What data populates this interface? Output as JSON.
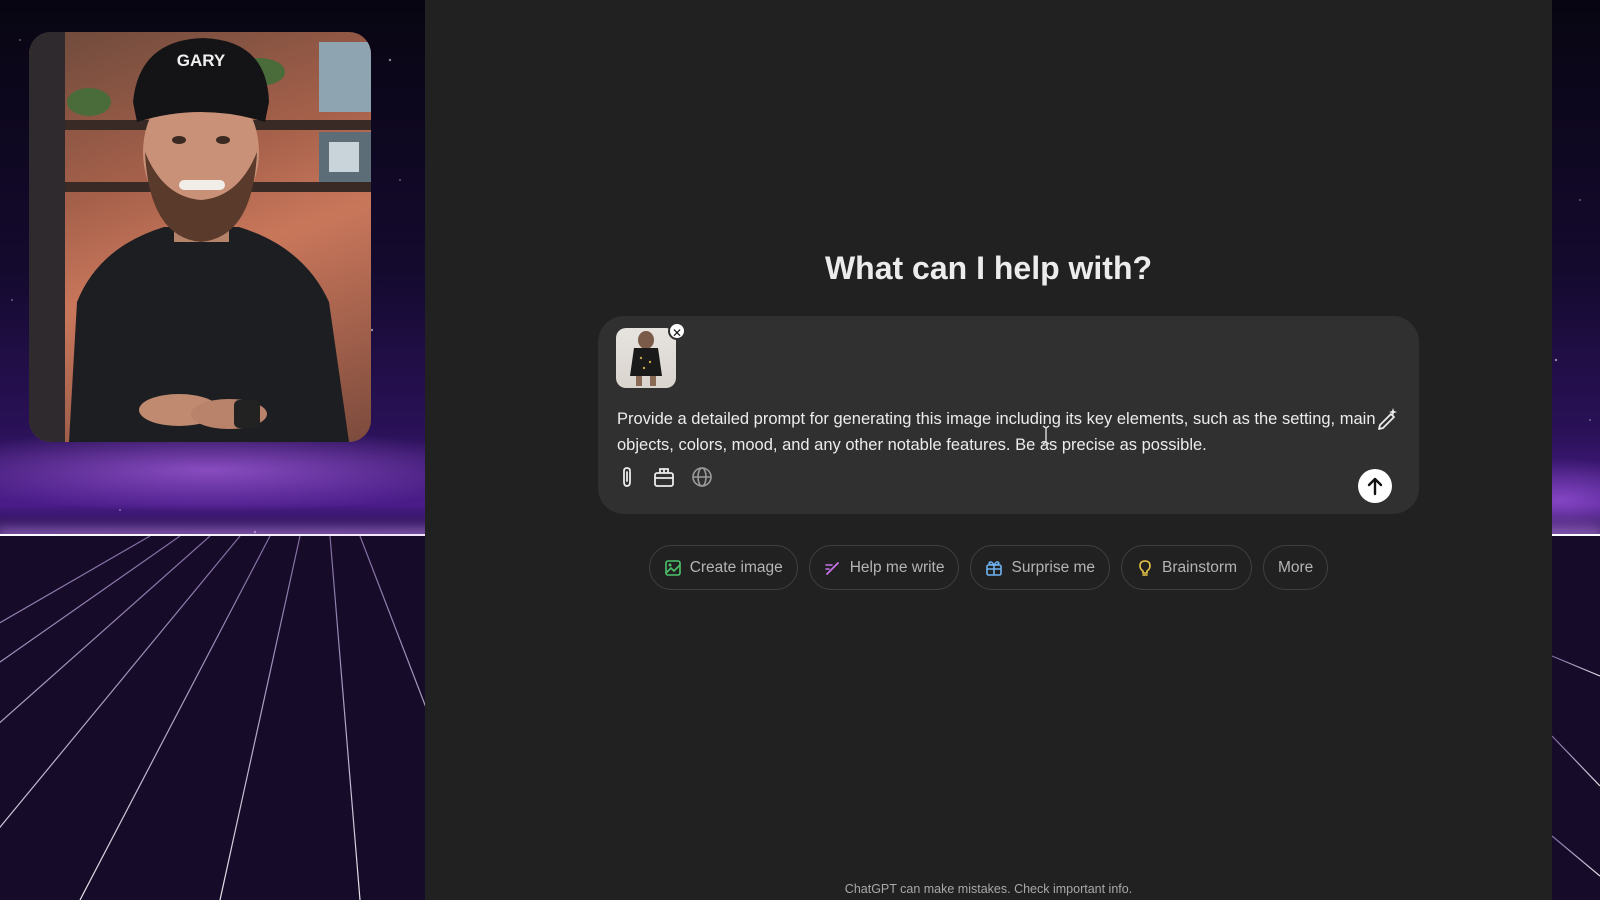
{
  "webcam": {
    "cap_text": "GARY"
  },
  "app": {
    "headline": "What can I help with?",
    "composer": {
      "attachment_remove": "✕",
      "prompt_text": "Provide a detailed prompt for generating this image including its key elements, such as the setting, main objects, colors, mood, and any other notable features. Be as precise as possible."
    },
    "chips": [
      {
        "label": "Create image",
        "icon": "image-icon",
        "color": "#4ec26b"
      },
      {
        "label": "Help me write",
        "icon": "pen-icon",
        "color": "#c774e8"
      },
      {
        "label": "Surprise me",
        "icon": "gift-icon",
        "color": "#6fb3f2"
      },
      {
        "label": "Brainstorm",
        "icon": "lightbulb-icon",
        "color": "#e8c547"
      },
      {
        "label": "More"
      }
    ],
    "footer": "ChatGPT can make mistakes. Check important info."
  },
  "colors": {
    "app_bg": "#212121",
    "composer_bg": "#303030",
    "text_primary": "#ececec",
    "text_secondary": "#b4b4b4"
  }
}
